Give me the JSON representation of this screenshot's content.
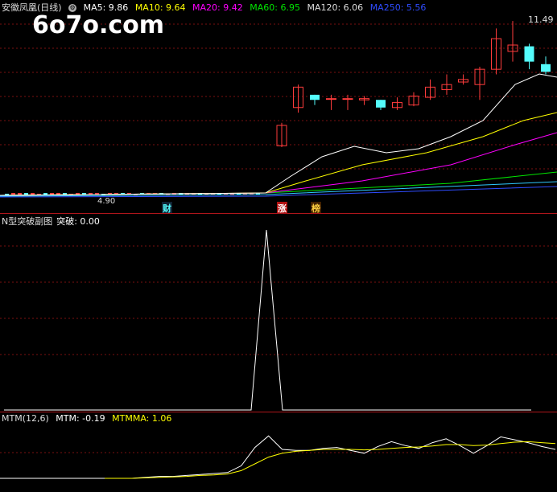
{
  "watermark": "6o7o.com",
  "main_header": {
    "title": "安徽凤凰(日线)",
    "ma5": "MA5: 9.86",
    "ma10": "MA10: 9.64",
    "ma20": "MA20: 9.42",
    "ma60": "MA60: 6.95",
    "ma120": "MA120: 6.06",
    "ma250": "MA250: 5.56"
  },
  "colors": {
    "up": "#ff3c3c",
    "down": "#54fcfc",
    "ma5": "#ffffff",
    "ma10": "#ffff00",
    "ma20": "#ff00ff",
    "ma60": "#00e600",
    "ma120": "#2ec9ff",
    "ma250": "#2f4cff",
    "grid": "#7a1010",
    "separator": "#b0151b"
  },
  "tags": {
    "cai": "财",
    "zhang": "涨",
    "bang": "榜"
  },
  "price_labels": {
    "high": "11.49",
    "low": "4.90"
  },
  "ind_header": {
    "name": "N型突破副图",
    "value": "突破: 0.00"
  },
  "mtm_header": {
    "name": "MTM(12,6)",
    "mtm": "MTM: -0.19",
    "mtmma": "MTMMA: 1.06"
  },
  "chart_data": [
    {
      "type": "candlestick",
      "title": "安徽凤凰(日线)",
      "ylim": [
        4.5,
        12.0
      ],
      "candles": [
        {
          "o": 6.6,
          "h": 7.5,
          "l": 6.55,
          "c": 7.4
        },
        {
          "o": 8.1,
          "h": 9.0,
          "l": 7.9,
          "c": 8.9
        },
        {
          "o": 8.6,
          "h": 8.6,
          "l": 8.2,
          "c": 8.4
        },
        {
          "o": 8.45,
          "h": 8.6,
          "l": 8.0,
          "c": 8.45
        },
        {
          "o": 8.45,
          "h": 8.6,
          "l": 8.0,
          "c": 8.45
        },
        {
          "o": 8.4,
          "h": 8.55,
          "l": 8.2,
          "c": 8.45
        },
        {
          "o": 8.4,
          "h": 8.4,
          "l": 8.0,
          "c": 8.1
        },
        {
          "o": 8.1,
          "h": 8.5,
          "l": 8.0,
          "c": 8.3
        },
        {
          "o": 8.2,
          "h": 8.7,
          "l": 8.15,
          "c": 8.55
        },
        {
          "o": 8.5,
          "h": 9.2,
          "l": 8.4,
          "c": 8.9
        },
        {
          "o": 8.8,
          "h": 9.4,
          "l": 8.6,
          "c": 9.0
        },
        {
          "o": 9.1,
          "h": 9.4,
          "l": 9.0,
          "c": 9.2
        },
        {
          "o": 9.0,
          "h": 9.7,
          "l": 8.4,
          "c": 9.6
        },
        {
          "o": 9.6,
          "h": 11.2,
          "l": 9.4,
          "c": 10.8
        },
        {
          "o": 10.3,
          "h": 11.49,
          "l": 9.9,
          "c": 10.55
        },
        {
          "o": 10.5,
          "h": 10.6,
          "l": 9.6,
          "c": 9.9
        },
        {
          "o": 9.8,
          "h": 10.1,
          "l": 9.4,
          "c": 9.5
        }
      ],
      "ma_values": {
        "ma5": 9.86,
        "ma10": 9.64,
        "ma20": 9.42,
        "ma60": 6.95,
        "ma120": 6.06,
        "ma250": 5.56
      }
    },
    {
      "type": "line",
      "title": "N型突破副图",
      "series": [
        {
          "name": "突破",
          "values": [
            0,
            0,
            0,
            0,
            0,
            0,
            0,
            0,
            0,
            1,
            0,
            0,
            0,
            0,
            0,
            0,
            0,
            0,
            0,
            0,
            0,
            0,
            0,
            0,
            0,
            0,
            0,
            0,
            0,
            0,
            0,
            0,
            0,
            0
          ]
        }
      ],
      "ylim": [
        0,
        1
      ]
    },
    {
      "type": "line",
      "title": "MTM(12,6)",
      "series": [
        {
          "name": "MTM",
          "values": [
            0,
            0,
            0,
            0.1,
            0.2,
            0.2,
            0.3,
            0.4,
            0.5,
            0.6,
            1.3,
            3.2,
            4.4,
            3.0,
            2.9,
            2.9,
            3.1,
            3.2,
            2.9,
            2.6,
            3.3,
            3.8,
            3.4,
            3.1,
            3.7,
            4.1,
            3.4,
            2.6,
            3.4,
            4.3,
            4.0,
            3.7,
            3.3,
            3.0
          ]
        },
        {
          "name": "MTMMA",
          "values": [
            0,
            0,
            0,
            0.05,
            0.1,
            0.15,
            0.2,
            0.3,
            0.35,
            0.45,
            0.8,
            1.5,
            2.2,
            2.6,
            2.8,
            2.9,
            3.0,
            3.0,
            3.0,
            2.95,
            3.0,
            3.1,
            3.2,
            3.25,
            3.35,
            3.5,
            3.5,
            3.4,
            3.45,
            3.6,
            3.75,
            3.8,
            3.7,
            3.6
          ]
        }
      ]
    }
  ]
}
